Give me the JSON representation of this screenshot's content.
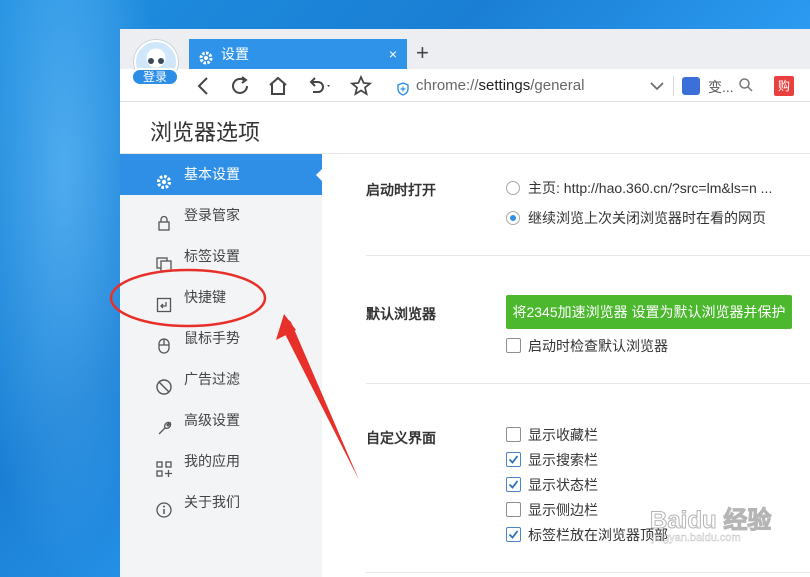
{
  "browser": {
    "login_label": "登录",
    "tab_title": "设置",
    "tab_close": "×",
    "new_tab": "+",
    "url_scheme": "chrome://",
    "url_host": "settings",
    "url_path": "/general",
    "search_text": "变...",
    "buy_label": "购"
  },
  "page": {
    "title": "浏览器选项"
  },
  "sidebar": {
    "items": [
      {
        "label": "基本设置",
        "icon": "gear-icon",
        "active": true
      },
      {
        "label": "登录管家",
        "icon": "lock-icon",
        "active": false
      },
      {
        "label": "标签设置",
        "icon": "tabs-icon",
        "active": false
      },
      {
        "label": "快捷键",
        "icon": "shortcut-icon",
        "active": false
      },
      {
        "label": "鼠标手势",
        "icon": "mouse-icon",
        "active": false
      },
      {
        "label": "广告过滤",
        "icon": "block-icon",
        "active": false
      },
      {
        "label": "高级设置",
        "icon": "wrench-icon",
        "active": false
      },
      {
        "label": "我的应用",
        "icon": "apps-icon",
        "active": false
      },
      {
        "label": "关于我们",
        "icon": "info-icon",
        "active": false
      }
    ]
  },
  "sections": {
    "startup": {
      "label": "启动时打开",
      "options": [
        {
          "label": "主页: http://hao.360.cn/?src=lm&ls=n ...",
          "selected": false
        },
        {
          "label": "继续浏览上次关闭浏览器时在看的网页",
          "selected": true
        }
      ]
    },
    "default_browser": {
      "label": "默认浏览器",
      "button": "将2345加速浏览器 设置为默认浏览器并保护",
      "check_label": "启动时检查默认浏览器",
      "checked": false
    },
    "ui": {
      "label": "自定义界面",
      "options": [
        {
          "label": "显示收藏栏",
          "checked": false
        },
        {
          "label": "显示搜索栏",
          "checked": true
        },
        {
          "label": "显示状态栏",
          "checked": true
        },
        {
          "label": "显示侧边栏",
          "checked": false
        },
        {
          "label": "标签栏放在浏览器顶部",
          "checked": true
        }
      ]
    }
  },
  "watermark": {
    "logo": "Baidu 经验",
    "url": "jingyan.baidu.com"
  },
  "colors": {
    "accent": "#2f8ee6",
    "green_button": "#4bb82e",
    "annotation_red": "#e8302a"
  }
}
